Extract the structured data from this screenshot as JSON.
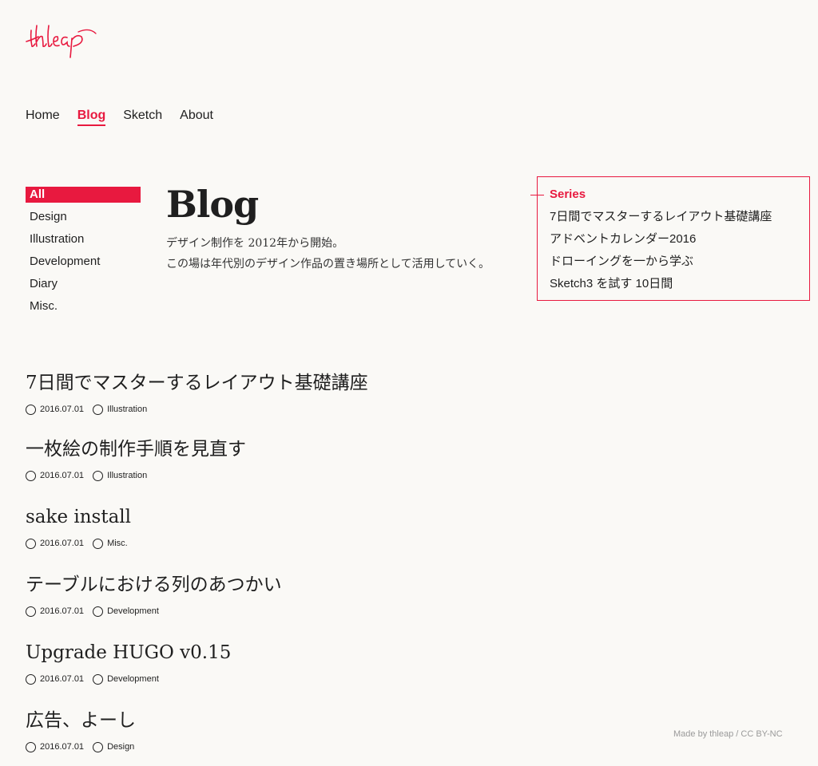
{
  "brand": {
    "logo_text": "thleap",
    "accent": "#e8193f"
  },
  "nav": {
    "items": [
      {
        "label": "Home",
        "active": false
      },
      {
        "label": "Blog",
        "active": true
      },
      {
        "label": "Sketch",
        "active": false
      },
      {
        "label": "About",
        "active": false
      }
    ]
  },
  "categories": [
    {
      "label": "All",
      "active": true
    },
    {
      "label": "Design",
      "active": false
    },
    {
      "label": "Illustration",
      "active": false
    },
    {
      "label": "Development",
      "active": false
    },
    {
      "label": "Diary",
      "active": false
    },
    {
      "label": "Misc.",
      "active": false
    }
  ],
  "intro": {
    "title": "Blog",
    "line1": "デザイン制作を 2012年から開始。",
    "line2": "この場は年代別のデザイン作品の置き場所として活用していく。"
  },
  "series": {
    "title": "Series",
    "items": [
      "7日間でマスターするレイアウト基礎講座",
      "アドベントカレンダー2016",
      "ドローイングを一から学ぶ",
      "Sketch3 を試す 10日間"
    ]
  },
  "posts": [
    {
      "title": "7日間でマスターするレイアウト基礎講座",
      "date": "2016.07.01",
      "category": "Illustration"
    },
    {
      "title": "一枚絵の制作手順を見直す",
      "date": "2016.07.01",
      "category": "Illustration"
    },
    {
      "title": "sake install",
      "date": "2016.07.01",
      "category": "Misc."
    },
    {
      "title": "テーブルにおける列のあつかい",
      "date": "2016.07.01",
      "category": "Development"
    },
    {
      "title": "Upgrade HUGO v0.15",
      "date": "2016.07.01",
      "category": "Development"
    },
    {
      "title": "広告、よーし",
      "date": "2016.07.01",
      "category": "Design"
    }
  ],
  "footer": {
    "text": "Made by  thleap / CC BY-NC"
  },
  "icons": {
    "date": "circle-icon",
    "category": "circle-icon"
  }
}
